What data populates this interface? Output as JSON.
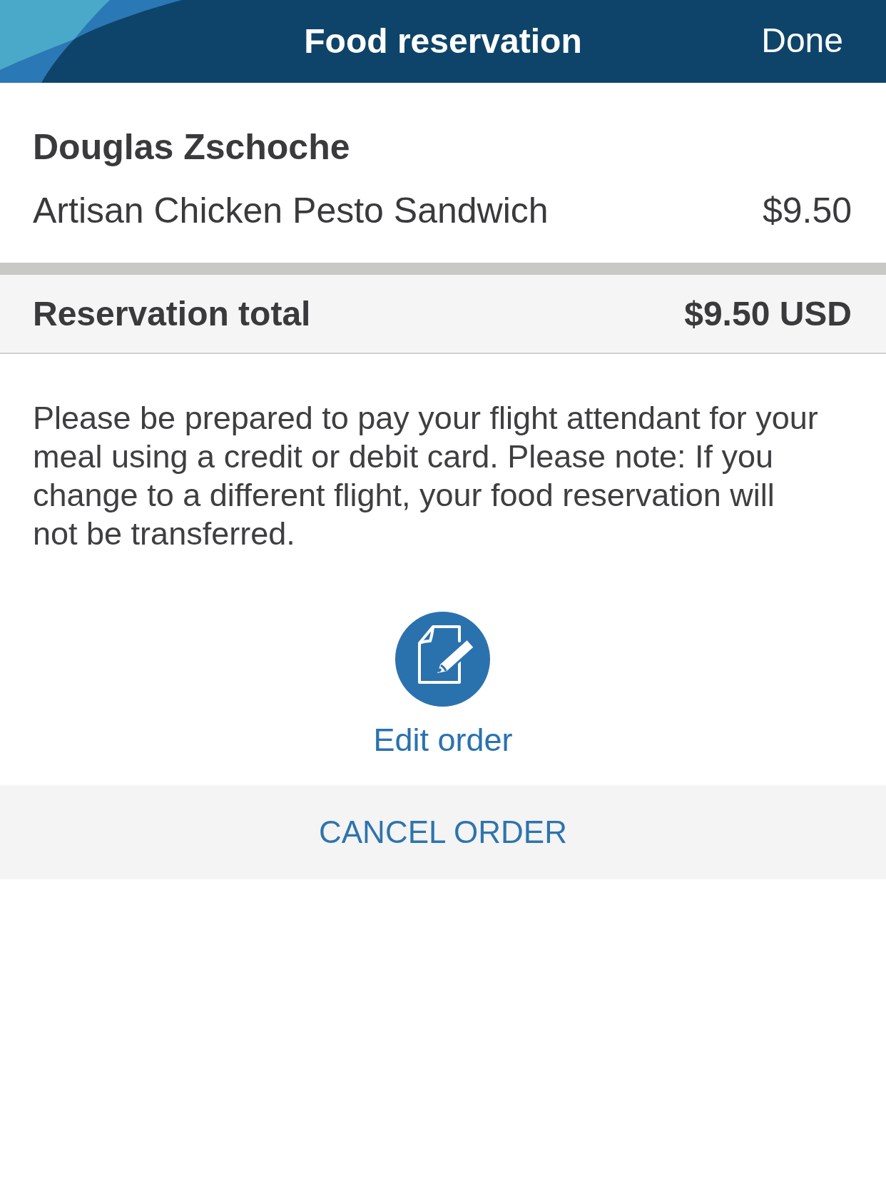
{
  "header": {
    "title": "Food reservation",
    "done_button": "Done"
  },
  "order": {
    "passenger": "Douglas Zschoche",
    "items": [
      {
        "name": "Artisan Chicken Pesto Sandwich",
        "price": "$9.50"
      }
    ]
  },
  "total": {
    "label": "Reservation total",
    "amount": "$9.50 USD"
  },
  "notice": "Please be prepared to pay your flight attendant for your meal using a credit or debit card. Please note: If you change to a different flight, your food reservation will not be transferred.",
  "edit_action": {
    "label": "Edit order"
  },
  "cancel_button": "CANCEL ORDER"
}
